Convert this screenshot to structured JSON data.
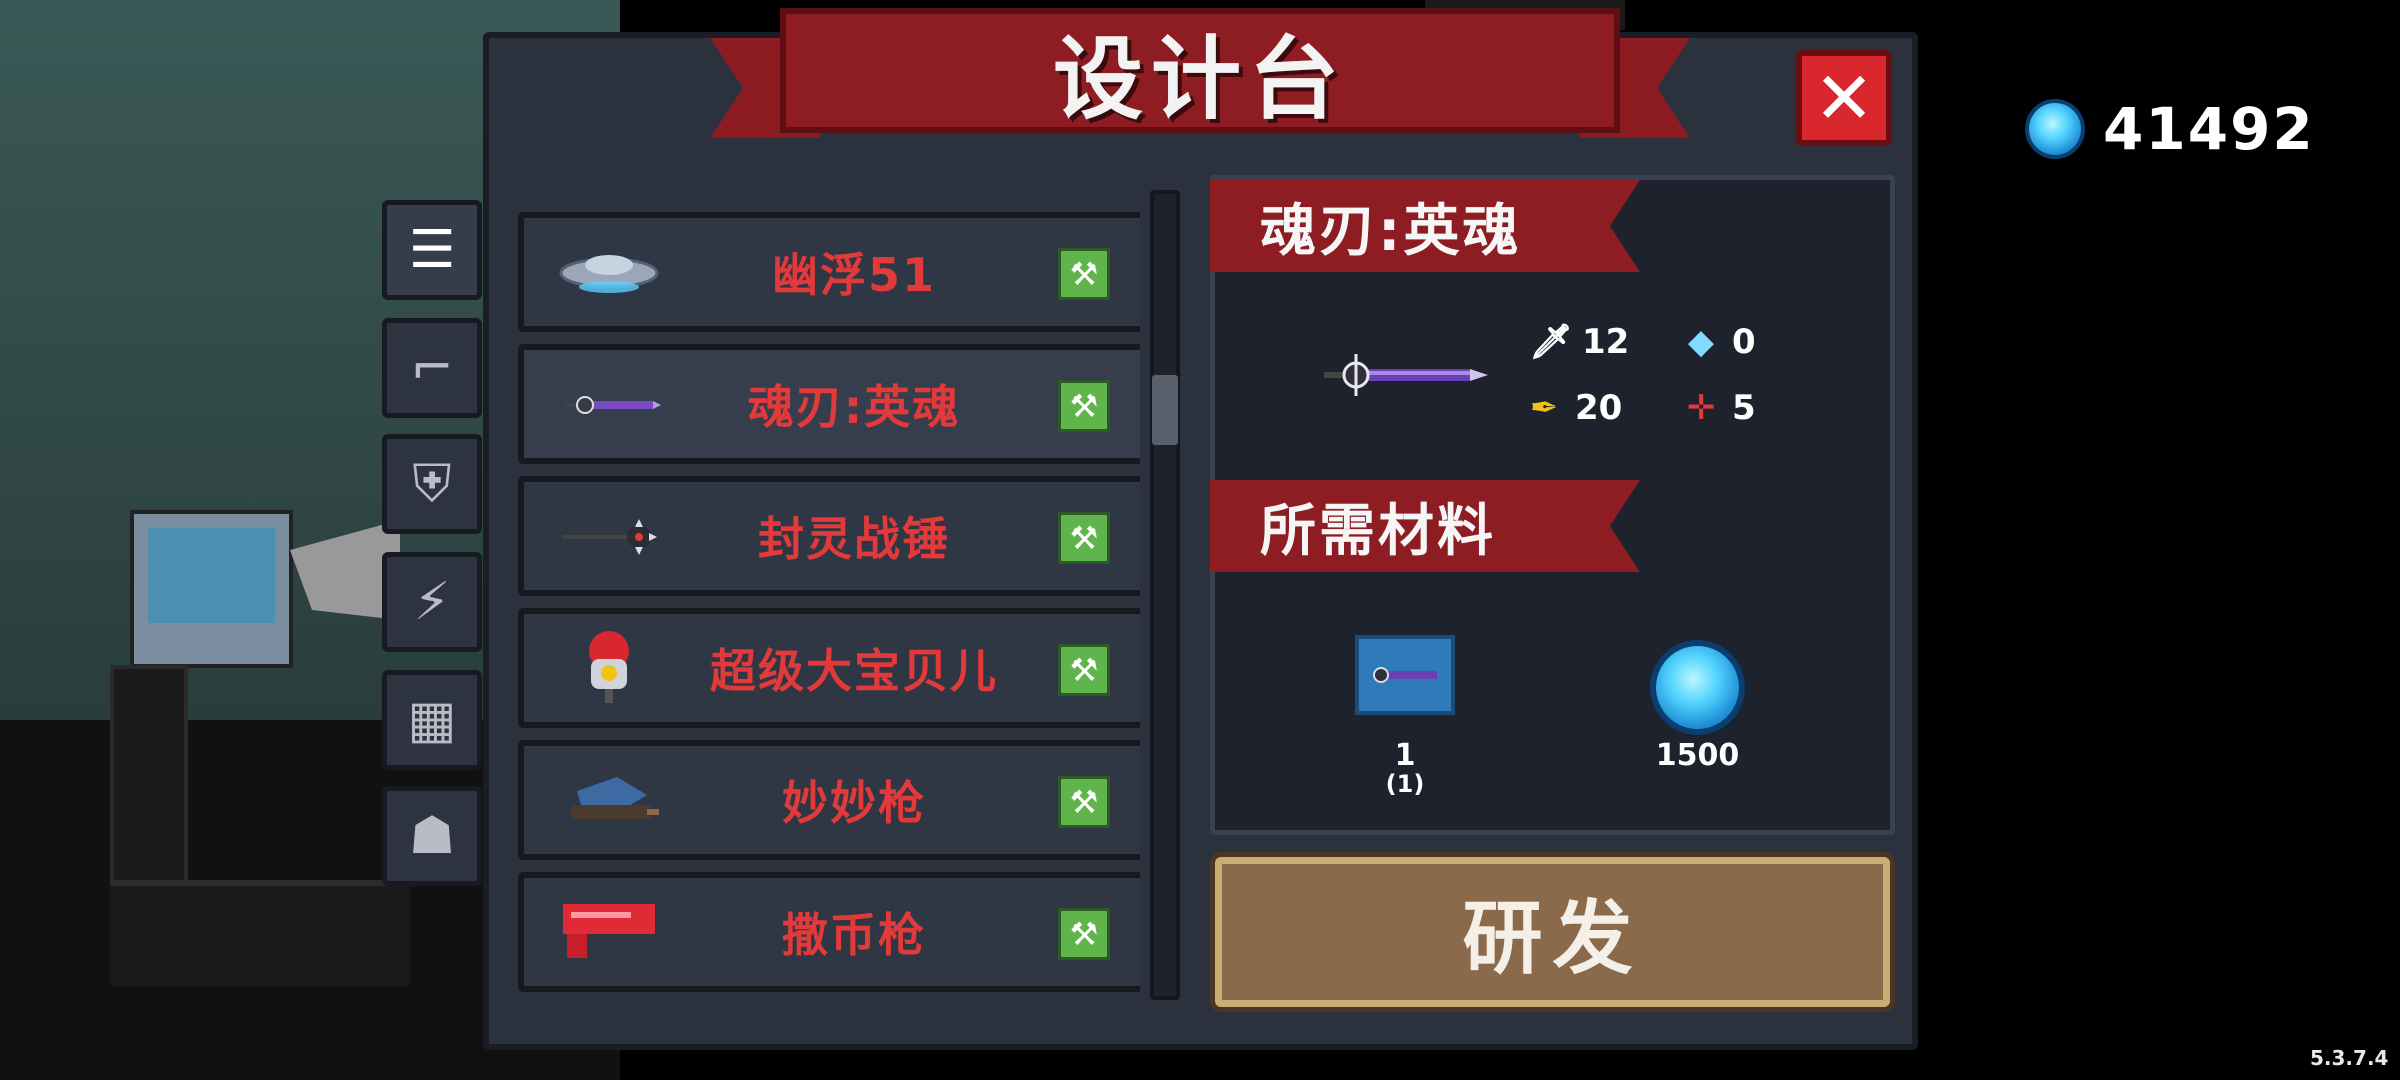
{
  "title": "设计台",
  "close_label": "✕",
  "currency": {
    "icon": "gem-icon",
    "value": "41492"
  },
  "side_tabs": [
    {
      "icon": "list-icon",
      "glyph": "☰"
    },
    {
      "icon": "gun-icon",
      "glyph": "⌐"
    },
    {
      "icon": "armor-icon",
      "glyph": "⛨"
    },
    {
      "icon": "lightning-icon",
      "glyph": "⚡"
    },
    {
      "icon": "blocks-icon",
      "glyph": "▦"
    },
    {
      "icon": "pet-icon",
      "glyph": "☗"
    }
  ],
  "items": [
    {
      "name": "幽浮51",
      "icon": "ufo-icon"
    },
    {
      "name": "魂刃:英魂",
      "icon": "sword-icon"
    },
    {
      "name": "封灵战锤",
      "icon": "mace-icon"
    },
    {
      "name": "超级大宝贝儿",
      "icon": "bomb-icon"
    },
    {
      "name": "妙妙枪",
      "icon": "turtle-gun-icon"
    },
    {
      "name": "撒币枪",
      "icon": "coin-gun-icon"
    }
  ],
  "selected": {
    "name": "魂刃:英魂",
    "stats": {
      "attack": "12",
      "energy": "0",
      "crit": "20",
      "precision": "5"
    }
  },
  "materials_title": "所需材料",
  "materials": [
    {
      "icon": "blueprint-icon",
      "count": "1",
      "owned": "(1)"
    },
    {
      "icon": "gem-icon",
      "count": "1500"
    }
  ],
  "develop_label": "研发",
  "version": "5.3.7.4",
  "colors": {
    "red_text": "#e23a3a",
    "banner": "#8d1c23",
    "button": "#8a6a4a"
  }
}
